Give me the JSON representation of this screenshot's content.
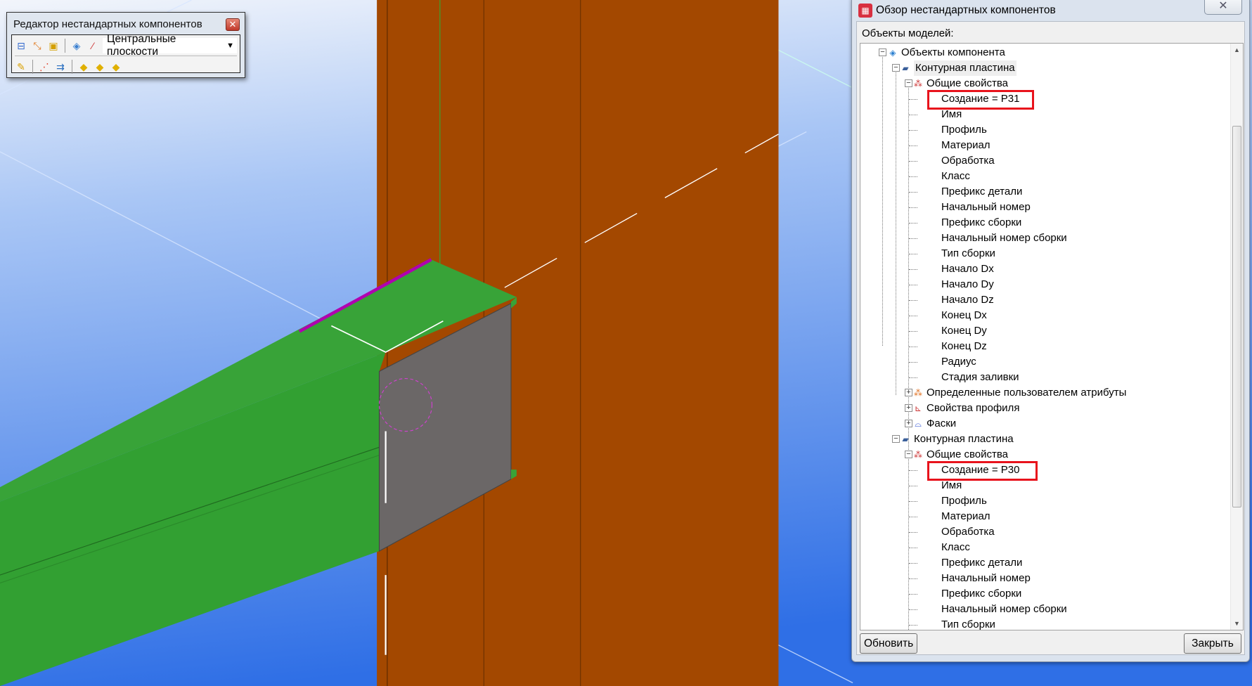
{
  "editor_toolbar": {
    "title": "Редактор нестандартных компонентов",
    "plane_select": "Центральные плоскости",
    "icons_row1": [
      "plane-icon",
      "measure-icon",
      "part-box-icon",
      "layer-icon",
      "dotted-line-icon"
    ],
    "icons_row2": [
      "add-variable-icon",
      "points-check-icon",
      "link-part-icon",
      "part-add-icon",
      "part-add2-icon",
      "part-delete-icon"
    ]
  },
  "browser_panel": {
    "title": "Обзор нестандартных компонентов",
    "objects_label": "Объекты моделей:",
    "refresh_button": "Обновить",
    "close_button": "Закрыть",
    "tree": [
      {
        "label": "Объекты компонента",
        "level": 0,
        "exp": "minus",
        "icon": "component-objects-icon"
      },
      {
        "label": "Контурная пластина",
        "level": 1,
        "exp": "minus",
        "icon": "contour-plate-icon",
        "selected": true
      },
      {
        "label": "Общие свойства",
        "level": 2,
        "exp": "minus",
        "icon": "properties-icon"
      },
      {
        "label": "Создание = P31",
        "level": 3,
        "highlight": true
      },
      {
        "label": "Имя",
        "level": 3
      },
      {
        "label": "Профиль",
        "level": 3
      },
      {
        "label": "Материал",
        "level": 3
      },
      {
        "label": "Обработка",
        "level": 3
      },
      {
        "label": "Класс",
        "level": 3
      },
      {
        "label": "Префикс детали",
        "level": 3
      },
      {
        "label": "Начальный номер",
        "level": 3
      },
      {
        "label": "Префикс сборки",
        "level": 3
      },
      {
        "label": "Начальный номер сборки",
        "level": 3
      },
      {
        "label": "Тип сборки",
        "level": 3
      },
      {
        "label": "Начало Dx",
        "level": 3
      },
      {
        "label": "Начало Dy",
        "level": 3
      },
      {
        "label": "Начало Dz",
        "level": 3
      },
      {
        "label": "Конец Dx",
        "level": 3
      },
      {
        "label": "Конец Dy",
        "level": 3
      },
      {
        "label": "Конец Dz",
        "level": 3
      },
      {
        "label": "Радиус",
        "level": 3
      },
      {
        "label": "Стадия заливки",
        "level": 3
      },
      {
        "label": "Определенные пользователем атрибуты",
        "level": 2,
        "exp": "plus",
        "icon": "user-attributes-icon"
      },
      {
        "label": "Свойства профиля",
        "level": 2,
        "exp": "plus",
        "icon": "profile-properties-icon"
      },
      {
        "label": "Фаски",
        "level": 2,
        "exp": "plus",
        "icon": "chamfers-icon"
      },
      {
        "label": "Контурная пластина",
        "level": 1,
        "exp": "minus",
        "icon": "contour-plate-icon"
      },
      {
        "label": "Общие свойства",
        "level": 2,
        "exp": "minus",
        "icon": "properties-icon"
      },
      {
        "label": "Создание = P30",
        "level": 3,
        "highlight": true
      },
      {
        "label": "Имя",
        "level": 3
      },
      {
        "label": "Профиль",
        "level": 3
      },
      {
        "label": "Материал",
        "level": 3
      },
      {
        "label": "Обработка",
        "level": 3
      },
      {
        "label": "Класс",
        "level": 3
      },
      {
        "label": "Префикс детали",
        "level": 3
      },
      {
        "label": "Начальный номер",
        "level": 3
      },
      {
        "label": "Префикс сборки",
        "level": 3
      },
      {
        "label": "Начальный номер сборки",
        "level": 3
      },
      {
        "label": "Тип сборки",
        "level": 3
      }
    ]
  },
  "colors": {
    "column": "#a34800",
    "beam": "#35a035",
    "plate": "#6b6767",
    "highlight": "#e8131c"
  }
}
